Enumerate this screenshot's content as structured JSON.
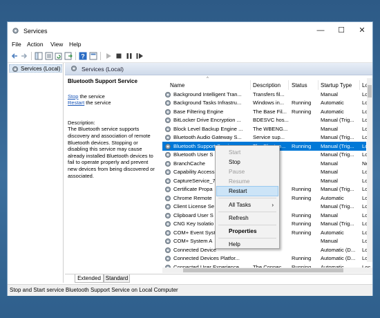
{
  "window": {
    "title": "Services",
    "controls": {
      "minimize": "—",
      "maximize": "☐",
      "close": "✕"
    }
  },
  "menubar": [
    "File",
    "Action",
    "View",
    "Help"
  ],
  "tree": {
    "item": "Services (Local)"
  },
  "pane": {
    "header": "Services (Local)",
    "service_title": "Bluetooth Support Service",
    "stop_link": "Stop",
    "stop_suffix": " the service",
    "restart_link": "Restart",
    "restart_suffix": " the service",
    "description_label": "Description:",
    "description_text": "The Bluetooth service supports discovery and association of remote Bluetooth devices.  Stopping or disabling this service may cause already installed Bluetooth devices to fail to operate properly and prevent new devices from being discovered or associated."
  },
  "table": {
    "columns": [
      "Name",
      "Description",
      "Status",
      "Startup Type",
      "Log"
    ],
    "rows": [
      [
        "Background Intelligent Tran...",
        "Transfers fil...",
        "",
        "Manual",
        "Loc"
      ],
      [
        "Background Tasks Infrastru...",
        "Windows in...",
        "Running",
        "Automatic",
        "Loc"
      ],
      [
        "Base Filtering Engine",
        "The Base Fil...",
        "Running",
        "Automatic",
        "Loc"
      ],
      [
        "BitLocker Drive Encryption ...",
        "BDESVC hos...",
        "",
        "Manual (Trig...",
        "Loc"
      ],
      [
        "Block Level Backup Engine ...",
        "The WBENG...",
        "",
        "Manual",
        "Loc"
      ],
      [
        "Bluetooth Audio Gateway S...",
        "Service sup...",
        "",
        "Manual (Trig...",
        "Loc"
      ],
      [
        "Bluetooth Support Service",
        "The Bluetoo...",
        "Running",
        "Manual (Trig...",
        "Loc"
      ],
      [
        "Bluetooth User S",
        "",
        "",
        "Manual (Trig...",
        "Loc"
      ],
      [
        "BranchCache",
        "",
        "",
        "Manual",
        "Net"
      ],
      [
        "Capability Access",
        "",
        "",
        "Manual",
        "Loc"
      ],
      [
        "CaptureService_7",
        "",
        "",
        "Manual",
        "Loc"
      ],
      [
        "Certificate Propa",
        "",
        "Running",
        "Manual (Trig...",
        "Loc"
      ],
      [
        "Chrome Remote",
        "",
        "Running",
        "Automatic",
        "Loc"
      ],
      [
        "Client License Se",
        "",
        "",
        "Manual (Trig...",
        "Loc"
      ],
      [
        "Clipboard User S",
        "",
        "Running",
        "Manual",
        "Loc"
      ],
      [
        "CNG Key Isolatio",
        "",
        "Running",
        "Manual (Trig...",
        "Loc"
      ],
      [
        "COM+ Event Syst",
        "",
        "Running",
        "Automatic",
        "Loc"
      ],
      [
        "COM+ System A",
        "",
        "",
        "Manual",
        "Loc"
      ],
      [
        "Connected Device",
        "",
        "",
        "Automatic (D...",
        "Loc"
      ],
      [
        "Connected Devices Platfor...",
        "",
        "Running",
        "Automatic (D...",
        "Loc"
      ],
      [
        "Connected User Experience...",
        "The Connec...",
        "Running",
        "Automatic",
        "Loc"
      ]
    ],
    "selected_row": 6
  },
  "context_menu": {
    "start": "Start",
    "stop": "Stop",
    "pause": "Pause",
    "resume": "Resume",
    "restart": "Restart",
    "all_tasks": "All Tasks",
    "refresh": "Refresh",
    "properties": "Properties",
    "help": "Help"
  },
  "tabs": [
    "Extended",
    "Standard"
  ],
  "statusbar": "Stop and Start service Bluetooth Support Service on Local Computer",
  "colors": {
    "selection": "#0078d7",
    "link": "#1a57b8",
    "hover": "#cce4f7"
  }
}
